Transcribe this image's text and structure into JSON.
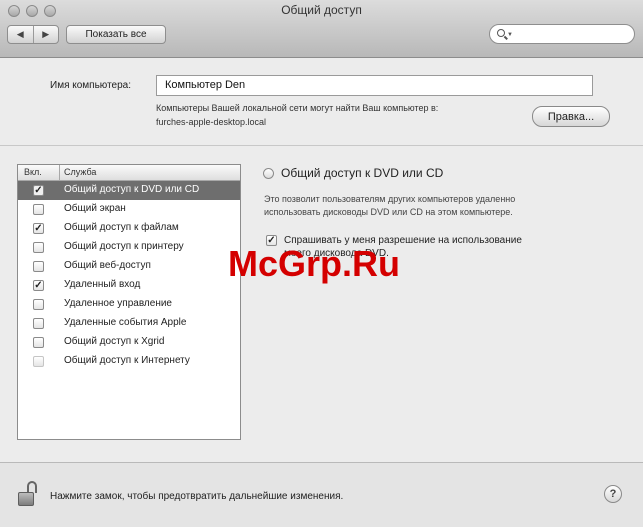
{
  "window": {
    "title": "Общий доступ"
  },
  "toolbar": {
    "back_glyph": "◀",
    "forward_glyph": "▶",
    "show_all_label": "Показать все",
    "search_placeholder": ""
  },
  "computer_name": {
    "label": "Имя компьютера:",
    "value": "Компьютер Den",
    "help_line1": "Компьютеры Вашей локальной сети могут найти Ваш компьютер в:",
    "help_line2": "furches-apple-desktop.local",
    "edit_button": "Правка..."
  },
  "services": {
    "col_on": "Вкл.",
    "col_service": "Служба",
    "items": [
      {
        "label": "Общий доступ к DVD или CD",
        "checked": true,
        "selected": true,
        "mark": "✓"
      },
      {
        "label": "Общий экран",
        "checked": false,
        "selected": false,
        "mark": ""
      },
      {
        "label": "Общий доступ к файлам",
        "checked": true,
        "selected": false,
        "mark": "✓"
      },
      {
        "label": "Общий доступ к принтеру",
        "checked": false,
        "selected": false,
        "mark": ""
      },
      {
        "label": "Общий веб-доступ",
        "checked": false,
        "selected": false,
        "mark": ""
      },
      {
        "label": "Удаленный вход",
        "checked": true,
        "selected": false,
        "mark": "✓"
      },
      {
        "label": "Удаленное управление",
        "checked": false,
        "selected": false,
        "mark": ""
      },
      {
        "label": "Удаленные события Apple",
        "checked": false,
        "selected": false,
        "mark": ""
      },
      {
        "label": "Общий доступ к Xgrid",
        "checked": false,
        "selected": false,
        "mark": ""
      },
      {
        "label": "Общий доступ к Интернету",
        "checked": false,
        "selected": false,
        "mark": ""
      }
    ]
  },
  "detail": {
    "heading": "Общий доступ к DVD или CD",
    "desc_line1": "Это позволит пользователям других компьютеров удаленно",
    "desc_line2": "использовать дисководы DVD или CD на этом компьютере.",
    "ask_line1": "Спрашивать у меня разрешение на использование",
    "ask_line2": "моего дисковода DVD.",
    "ask_checked": true,
    "ask_mark": "✓"
  },
  "footer": {
    "lock_text": "Нажмите замок, чтобы предотвратить дальнейшие изменения.",
    "help_label": "?"
  },
  "watermark": "McGrp.Ru"
}
